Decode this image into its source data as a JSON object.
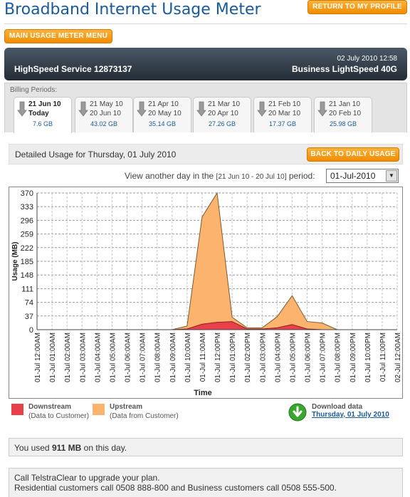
{
  "header": {
    "title": "Broadband Internet Usage Meter",
    "profile_button": "RETURN TO MY PROFILE",
    "menu_button": "MAIN USAGE METER MENU"
  },
  "banner": {
    "service": "HighSpeed Service 12873137",
    "datetime": "02 July 2010 12:58",
    "plan": "Business LightSpeed 40G"
  },
  "billing": {
    "label": "Billing Periods:",
    "periods": [
      {
        "line1": "21 Jun 10",
        "line2": "Today",
        "usage": "7.6 GB",
        "active": true
      },
      {
        "line1": "21 May 10",
        "line2": "20 Jun 10",
        "usage": "43.02 GB",
        "active": false
      },
      {
        "line1": "21 Apr 10",
        "line2": "20 May 10",
        "usage": "35.14 GB",
        "active": false
      },
      {
        "line1": "21 Mar 10",
        "line2": "20 Apr 10",
        "usage": "27.26 GB",
        "active": false
      },
      {
        "line1": "21 Feb 10",
        "line2": "20 Mar 10",
        "usage": "17.37 GB",
        "active": false
      },
      {
        "line1": "21 Jan 10",
        "line2": "20 Feb 10",
        "usage": "25.98 GB",
        "active": false
      }
    ]
  },
  "detail": {
    "title": "Detailed Usage for Thursday, 01 July 2010",
    "back_button": "BACK TO DAILY USAGE",
    "view_prefix": "View another day in the",
    "view_period": "[21 Jun 10 - 20 Jul 10]",
    "view_suffix": "period:",
    "selected_date": "01-Jul-2010"
  },
  "chart_data": {
    "type": "area",
    "xlabel": "Time",
    "ylabel": "Usage (MB)",
    "ylim": [
      0,
      370
    ],
    "yticks": [
      0,
      37,
      74,
      111,
      148,
      185,
      222,
      259,
      296,
      333,
      370
    ],
    "grid": true,
    "categories": [
      "01-Jul 12:00AM",
      "01-Jul 01:00AM",
      "01-Jul 02:00AM",
      "01-Jul 03:00AM",
      "01-Jul 04:00AM",
      "01-Jul 05:00AM",
      "01-Jul 06:00AM",
      "01-Jul 07:00AM",
      "01-Jul 08:00AM",
      "01-Jul 09:00AM",
      "01-Jul 10:00AM",
      "01-Jul 11:00AM",
      "01-Jul 12:00PM",
      "01-Jul 01:00PM",
      "01-Jul 02:00PM",
      "01-Jul 03:00PM",
      "01-Jul 04:00PM",
      "01-Jul 05:00PM",
      "01-Jul 06:00PM",
      "01-Jul 07:00PM",
      "01-Jul 08:00PM",
      "01-Jul 09:00PM",
      "01-Jul 10:00PM",
      "01-Jul 11:00PM",
      "02-Jul 12:00AM"
    ],
    "series": [
      {
        "name": "Downstream",
        "color": "#e8404a",
        "values": [
          0,
          0,
          0,
          0,
          0,
          0,
          0,
          0,
          0,
          0,
          2,
          15,
          20,
          22,
          2,
          2,
          5,
          14,
          2,
          0,
          0,
          0,
          0,
          0,
          0
        ]
      },
      {
        "name": "Upstream",
        "color": "#fbb36e",
        "values": [
          0,
          0,
          0,
          0,
          0,
          0,
          0,
          0,
          0,
          0,
          8,
          290,
          350,
          12,
          3,
          3,
          30,
          78,
          20,
          18,
          0,
          0,
          0,
          0,
          0
        ]
      }
    ]
  },
  "legend": {
    "downstream_label": "Downstream",
    "downstream_desc": "(Data to Customer)",
    "downstream_color": "#e8404a",
    "upstream_label": "Upstream",
    "upstream_desc": "(Data from Customer)",
    "upstream_color": "#fbb36e"
  },
  "download": {
    "label": "Download data",
    "link": "Thursday, 01 July 2010"
  },
  "summary": {
    "prefix": "You used",
    "amount": "911 MB",
    "suffix": "on this day."
  },
  "upgrade": {
    "line1": "Call TelstraClear to upgrade your plan.",
    "line2": "Residential customers call 0508 888-800 and Business customers call 0508 555-500."
  },
  "colors": {
    "brand_blue": "#1a5a96",
    "accent_orange": "#f08c00",
    "banner_dark": "#2e3640"
  }
}
